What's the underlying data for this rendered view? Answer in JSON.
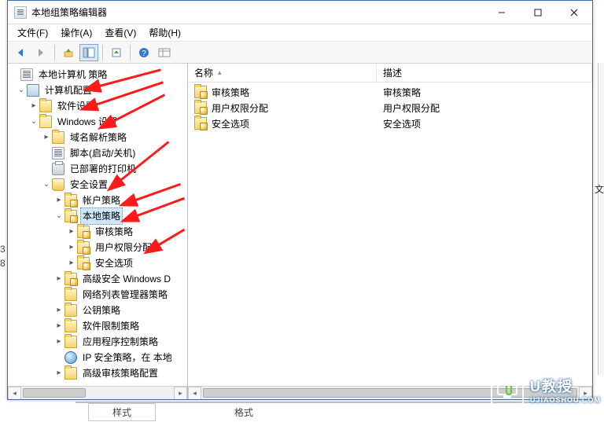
{
  "window": {
    "title": "本地组策略编辑器"
  },
  "menu": {
    "file": "文件(F)",
    "action": "操作(A)",
    "view": "查看(V)",
    "help": "帮助(H)"
  },
  "tree": {
    "root": "本地计算机 策略",
    "computer_config": "计算机配置",
    "software_settings": "软件设置",
    "windows_settings": "Windows 设置",
    "dns_policy": "域名解析策略",
    "scripts": "脚本(启动/关机)",
    "deployed_printers": "已部署的打印机",
    "security_settings": "安全设置",
    "account_policies": "帐户策略",
    "local_policies": "本地策略",
    "audit_policy": "审核策略",
    "user_rights": "用户权限分配",
    "security_options": "安全选项",
    "adv_windows_d": "高级安全 Windows D",
    "network_list": "网络列表管理器策略",
    "public_key": "公钥策略",
    "software_restriction": "软件限制策略",
    "app_control": "应用程序控制策略",
    "ip_security": "IP 安全策略，在 本地",
    "adv_audit": "高级审核策略配置"
  },
  "columns": {
    "name": "名称",
    "desc": "描述"
  },
  "list": {
    "r1_name": "审核策略",
    "r1_desc": "审核策略",
    "r2_name": "用户权限分配",
    "r2_desc": "用户权限分配",
    "r3_name": "安全选项",
    "r3_desc": "安全选项"
  },
  "bg": {
    "left1": "3",
    "left2": "8",
    "bottom_style": "样式",
    "bottom_fmt": "格式",
    "right_cut": "文"
  },
  "watermark": {
    "big": "U教授",
    "small": "UJIAOSHOU.COM"
  }
}
